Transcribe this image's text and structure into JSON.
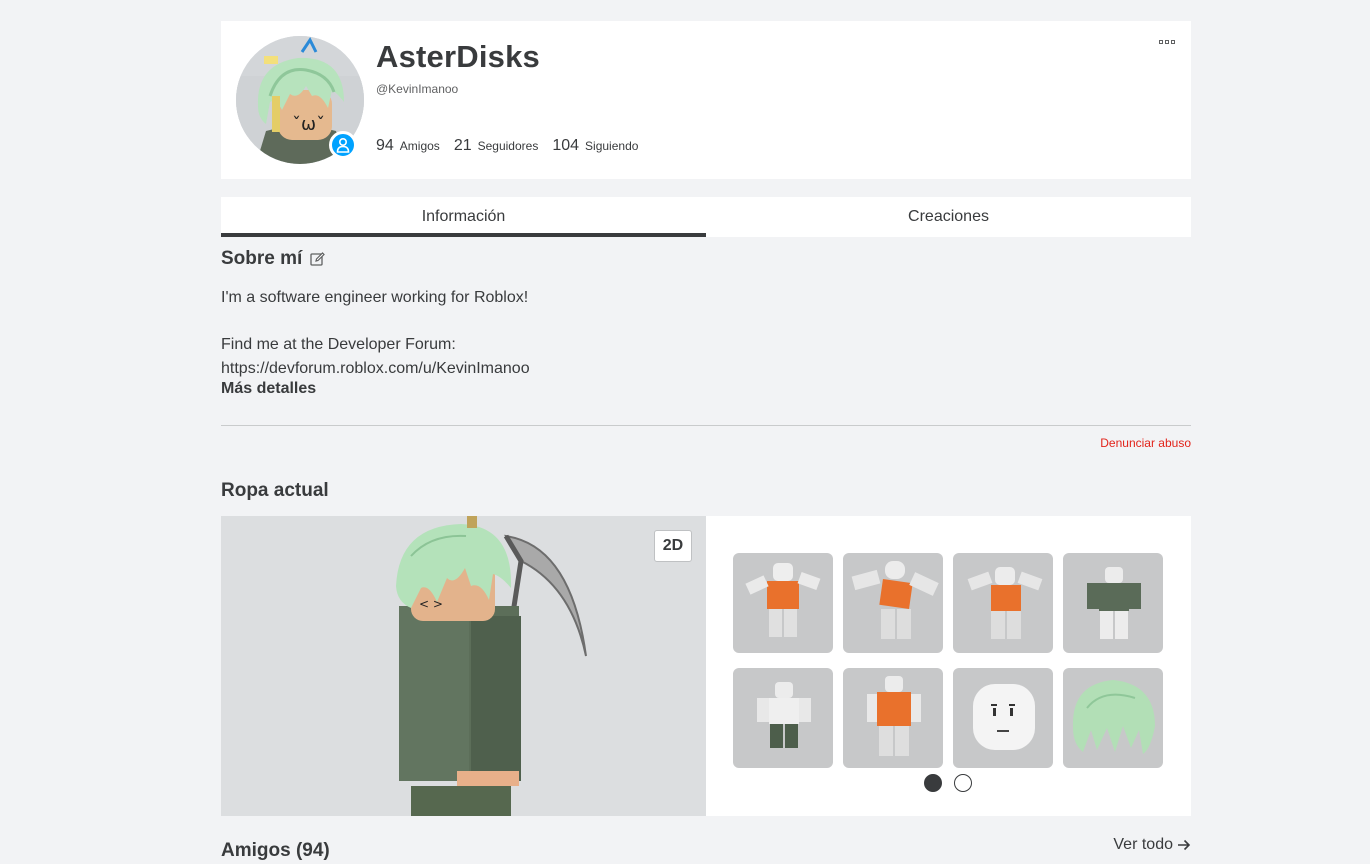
{
  "profile": {
    "display_name": "AsterDisks",
    "username": "@KevinImanoo",
    "stats": [
      {
        "value": "94",
        "label": "Amigos"
      },
      {
        "value": "21",
        "label": "Seguidores"
      },
      {
        "value": "104",
        "label": "Siguiendo"
      }
    ]
  },
  "tabs": [
    {
      "label": "Información",
      "active": true
    },
    {
      "label": "Creaciones",
      "active": false
    }
  ],
  "about": {
    "title": "Sobre mí",
    "lines": [
      "I'm a software engineer working for Roblox!",
      "",
      "Find me at the Developer Forum:"
    ],
    "link": "https://devforum.roblox.com/u/KevinImanoo",
    "more_details": "Más detalles",
    "report": "Denunciar abuso"
  },
  "outfit": {
    "title": "Ropa actual",
    "toggle_label": "2D",
    "items": [
      "emote-1",
      "emote-2",
      "emote-3",
      "shirt",
      "pants",
      "outfit",
      "face",
      "hair"
    ],
    "page_count": 2,
    "active_page": 1
  },
  "friends": {
    "title": "Amigos (94)",
    "see_all": "Ver todo"
  },
  "colors": {
    "accent": "#00a2ff",
    "report": "#e2231a",
    "hair": "#a9dcb3",
    "suit": "#5b6e58"
  }
}
